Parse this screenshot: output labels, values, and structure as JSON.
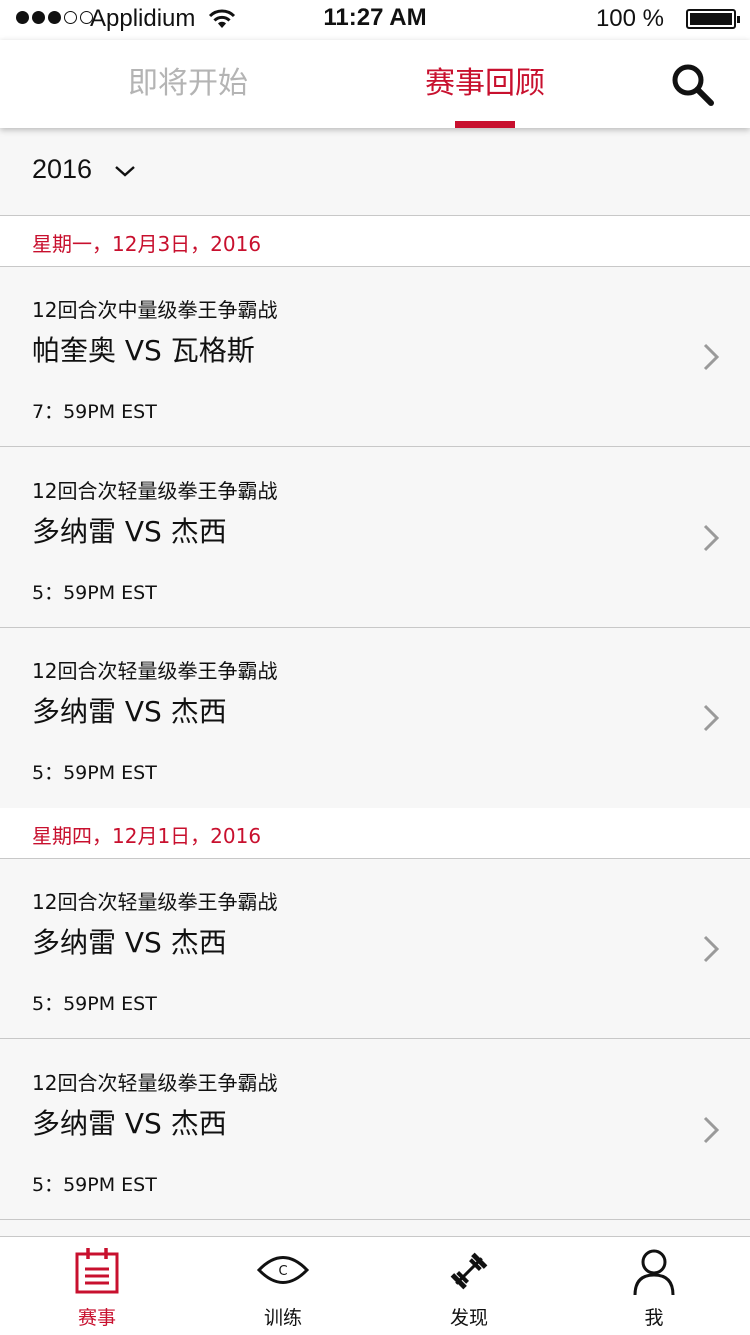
{
  "status_bar": {
    "carrier": "Applidium",
    "time": "11:27 AM",
    "battery_text": "100 %",
    "signal_bars_filled": 3,
    "signal_bars_total": 5
  },
  "top_nav": {
    "tabs": [
      {
        "label": "即将开始",
        "active": false
      },
      {
        "label": "赛事回顾",
        "active": true
      }
    ],
    "search_icon": "search-icon"
  },
  "year_selector": {
    "year": "2016",
    "icon": "chevron-down-icon"
  },
  "sections": [
    {
      "date": "星期一，12月3日，2016",
      "events": [
        {
          "title": "12回合次中量级拳王争霸战",
          "match": "帕奎奥 VS 瓦格斯",
          "time": "7：59PM EST"
        },
        {
          "title": "12回合次轻量级拳王争霸战",
          "match": "多纳雷 VS 杰西",
          "time": "5：59PM EST"
        },
        {
          "title": "12回合次轻量级拳王争霸战",
          "match": "多纳雷 VS 杰西",
          "time": "5：59PM EST"
        }
      ]
    },
    {
      "date": "星期四，12月1日，2016",
      "events": [
        {
          "title": "12回合次轻量级拳王争霸战",
          "match": "多纳雷 VS 杰西",
          "time": "5：59PM EST"
        },
        {
          "title": "12回合次轻量级拳王争霸战",
          "match": "多纳雷 VS 杰西",
          "time": "5：59PM EST"
        }
      ]
    }
  ],
  "bottom_tabs": [
    {
      "label": "赛事",
      "icon": "calendar-icon",
      "active": true
    },
    {
      "label": "训练",
      "icon": "eye-icon",
      "active": false
    },
    {
      "label": "发现",
      "icon": "dumbbell-icon",
      "active": false
    },
    {
      "label": "我",
      "icon": "person-icon",
      "active": false
    }
  ],
  "colors": {
    "accent": "#c8102e",
    "inactive_tab": "#b4b4b4",
    "background": "#f7f7f7",
    "divider": "#c8c8c8"
  }
}
